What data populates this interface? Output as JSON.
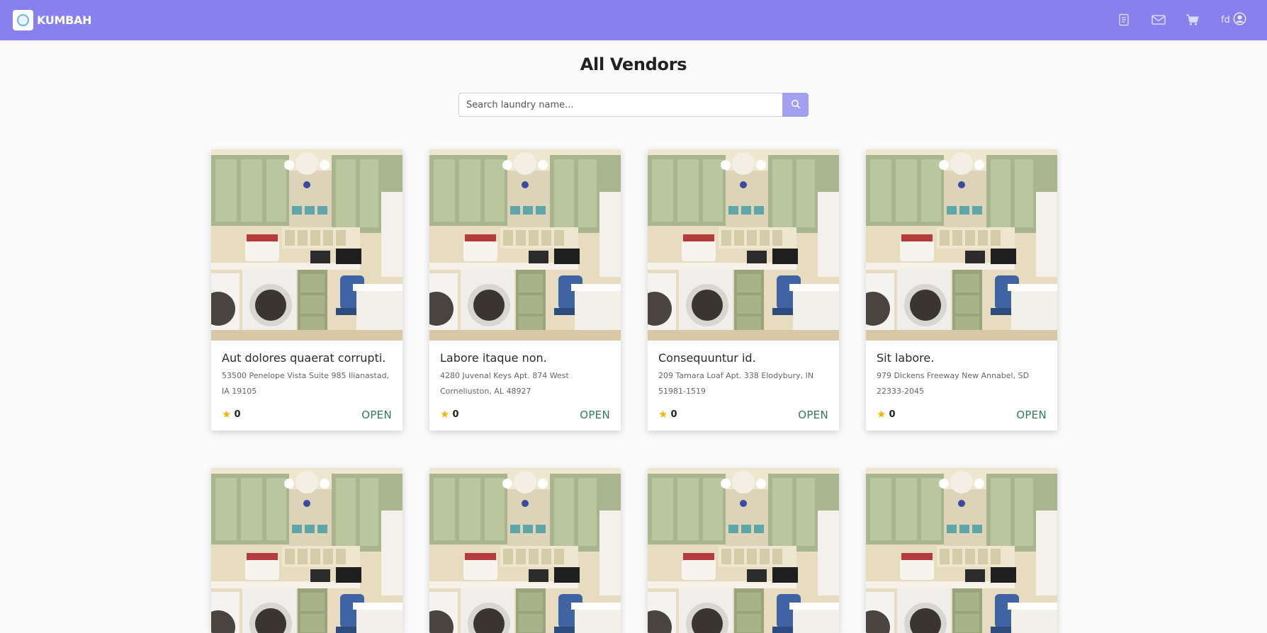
{
  "brand": {
    "name": "KUMBAH"
  },
  "nav": {
    "icons": [
      "orders-icon",
      "mail-icon",
      "cart-icon",
      "user-circle-icon"
    ],
    "username": "fd"
  },
  "page": {
    "title": "All Vendors"
  },
  "search": {
    "placeholder": "Search laundry name..."
  },
  "vendors": [
    {
      "name": "Aut dolores quaerat corrupti.",
      "address": "53500 Penelope Vista Suite 985 Ilianastad, IA 19105",
      "rating": "0",
      "status": "OPEN"
    },
    {
      "name": "Labore itaque non.",
      "address": "4280 Juvenal Keys Apt. 874 West Corneliuston, AL 48927",
      "rating": "0",
      "status": "OPEN"
    },
    {
      "name": "Consequuntur id.",
      "address": "209 Tamara Loaf Apt. 338 Elodybury, IN 51981-1519",
      "rating": "0",
      "status": "OPEN"
    },
    {
      "name": "Sit labore.",
      "address": "979 Dickens Freeway New Annabel, SD 22333-2045",
      "rating": "0",
      "status": "OPEN"
    }
  ],
  "colors": {
    "navbar": "#8681ee",
    "search_button": "#a3a0f2",
    "status_open": "#2e7d52",
    "star": "#f5b400"
  }
}
